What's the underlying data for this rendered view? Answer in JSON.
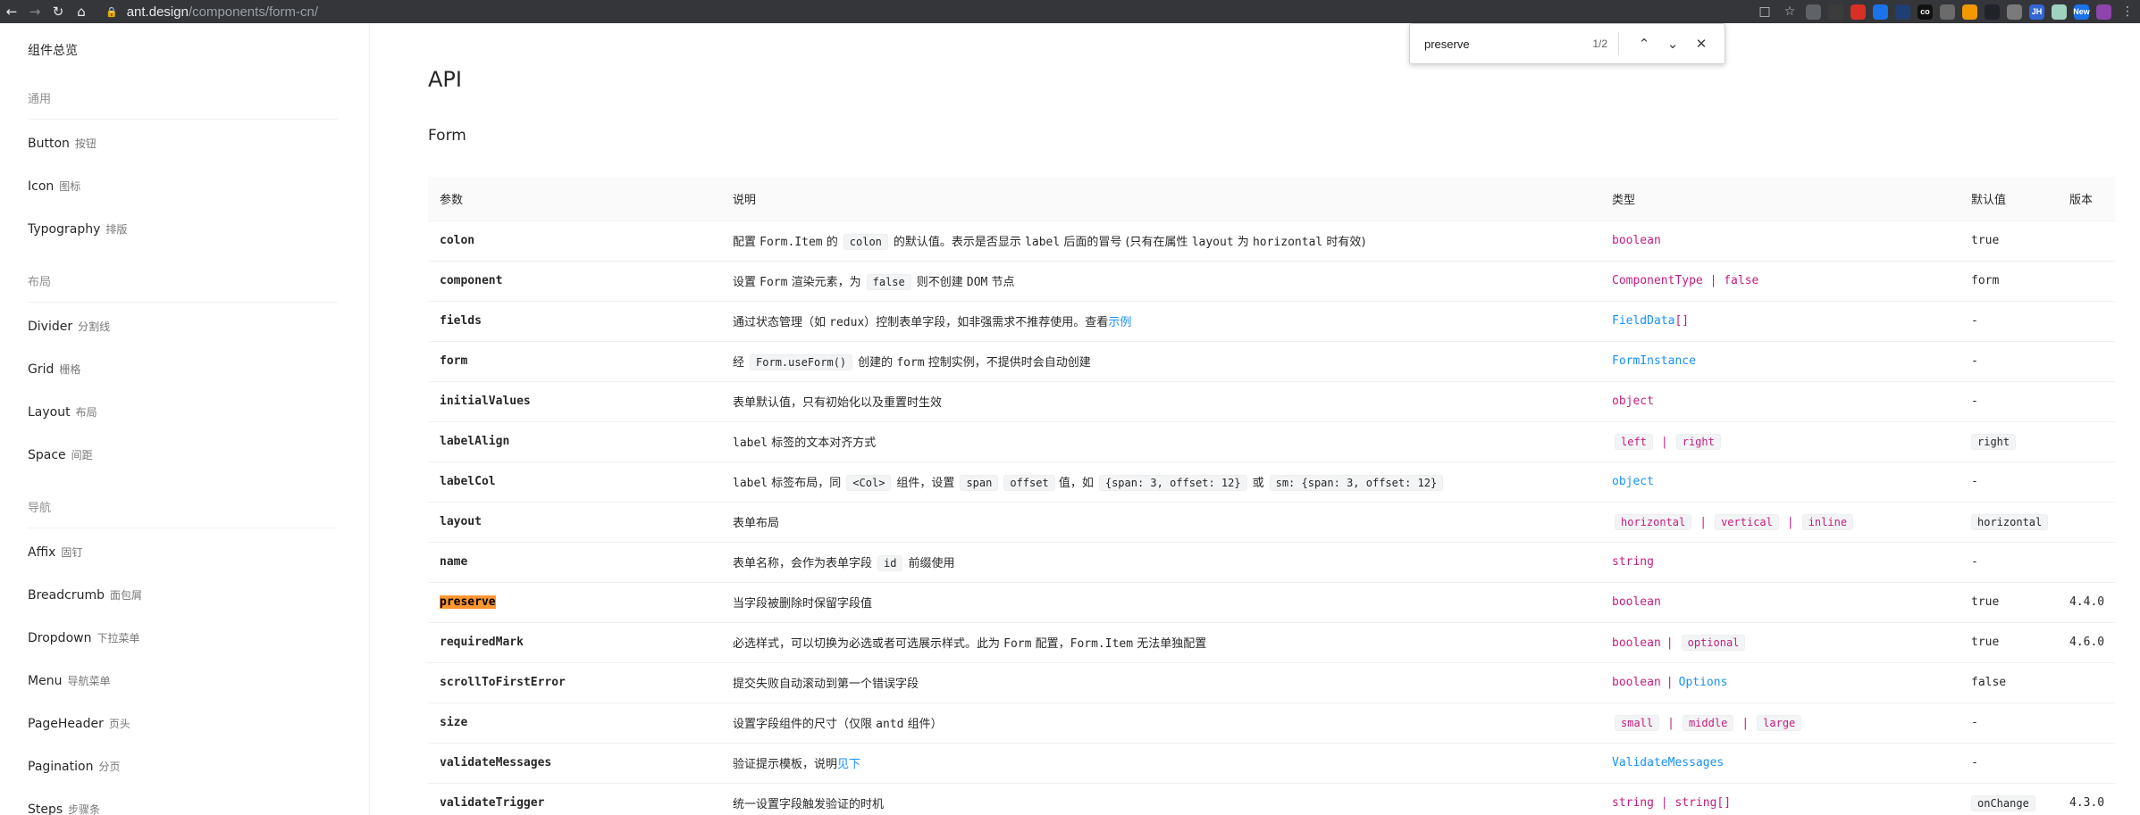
{
  "browser": {
    "url_host": "ant.design",
    "url_path": "/components/form-cn/",
    "find": {
      "query": "preserve",
      "count": "1/2"
    },
    "extensions": [
      {
        "name": "ext-gray",
        "color": "#5f6368",
        "text": ""
      },
      {
        "name": "ext-dark",
        "color": "#3c3c3c",
        "text": ""
      },
      {
        "name": "ext-red",
        "color": "#d93025",
        "text": ""
      },
      {
        "name": "ext-blue",
        "color": "#1a73e8",
        "text": ""
      },
      {
        "name": "ext-navy",
        "color": "#1f3f74",
        "text": ""
      },
      {
        "name": "ext-black",
        "color": "#111111",
        "text": "co"
      },
      {
        "name": "ext-white",
        "color": "#6b6b6b",
        "text": ""
      },
      {
        "name": "ext-chrome",
        "color": "#f29900",
        "text": ""
      },
      {
        "name": "ext-react",
        "color": "#20232a",
        "text": ""
      },
      {
        "name": "ext-circle",
        "color": "#7a7a7a",
        "text": ""
      },
      {
        "name": "ext-jh",
        "color": "#3367d6",
        "text": "JH"
      },
      {
        "name": "ext-green",
        "color": "#9fd3c0",
        "text": ""
      },
      {
        "name": "ext-new",
        "color": "#1a73e8",
        "text": "New"
      },
      {
        "name": "ext-moon",
        "color": "#8e44ad",
        "text": ""
      }
    ]
  },
  "sidebar": {
    "overview": "组件总览",
    "groups": [
      {
        "label": "通用",
        "items": [
          {
            "en": "Button",
            "cn": "按钮"
          },
          {
            "en": "Icon",
            "cn": "图标"
          },
          {
            "en": "Typography",
            "cn": "排版"
          }
        ]
      },
      {
        "label": "布局",
        "items": [
          {
            "en": "Divider",
            "cn": "分割线"
          },
          {
            "en": "Grid",
            "cn": "栅格"
          },
          {
            "en": "Layout",
            "cn": "布局"
          },
          {
            "en": "Space",
            "cn": "间距"
          }
        ]
      },
      {
        "label": "导航",
        "items": [
          {
            "en": "Affix",
            "cn": "固钉"
          },
          {
            "en": "Breadcrumb",
            "cn": "面包屑"
          },
          {
            "en": "Dropdown",
            "cn": "下拉菜单"
          },
          {
            "en": "Menu",
            "cn": "导航菜单"
          },
          {
            "en": "PageHeader",
            "cn": "页头"
          },
          {
            "en": "Pagination",
            "cn": "分页"
          },
          {
            "en": "Steps",
            "cn": "步骤条"
          }
        ]
      }
    ]
  },
  "main": {
    "title": "API",
    "subtitle": "Form",
    "table": {
      "headers": [
        "参数",
        "说明",
        "类型",
        "默认值",
        "版本"
      ],
      "rows": [
        {
          "param": "colon",
          "default": "true",
          "version": ""
        },
        {
          "param": "component",
          "default": "form",
          "version": ""
        },
        {
          "param": "fields",
          "default": "-",
          "version": ""
        },
        {
          "param": "form",
          "default": "-",
          "version": ""
        },
        {
          "param": "initialValues",
          "default": "-",
          "version": ""
        },
        {
          "param": "labelAlign",
          "default": "right",
          "version": ""
        },
        {
          "param": "labelCol",
          "default": "-",
          "version": ""
        },
        {
          "param": "layout",
          "default": "horizontal",
          "version": ""
        },
        {
          "param": "name",
          "default": "-",
          "version": ""
        },
        {
          "param": "preserve",
          "default": "true",
          "version": "4.4.0"
        },
        {
          "param": "requiredMark",
          "default": "true",
          "version": "4.6.0"
        },
        {
          "param": "scrollToFirstError",
          "default": "false",
          "version": ""
        },
        {
          "param": "size",
          "default": "-",
          "version": ""
        },
        {
          "param": "validateMessages",
          "default": "-",
          "version": ""
        },
        {
          "param": "validateTrigger",
          "default": "onChange",
          "version": "4.3.0"
        }
      ],
      "desc": {
        "colon": {
          "a": "配置",
          "b": "Form.Item",
          "c": "的",
          "d": "colon",
          "e": "的默认值。表示是否显示",
          "f": "label",
          "g": "后面的冒号 (只有在属性",
          "h": "layout",
          "i": "为",
          "j": "horizontal",
          "k": "时有效)"
        },
        "component": {
          "a": "设置",
          "b": "Form",
          "c": "渲染元素，为",
          "d": "false",
          "e": "则不创建",
          "f": "DOM",
          "g": "节点"
        },
        "fields": {
          "a": "通过状态管理（如",
          "b": "redux",
          "c": "）控制表单字段，如非强需求不推荐使用。查看",
          "link": "示例"
        },
        "form": {
          "a": "经",
          "b": "Form.useForm()",
          "c": "创建的",
          "d": "form",
          "e": "控制实例，不提供时会自动创建"
        },
        "initialValues": "表单默认值，只有初始化以及重置时生效",
        "labelAlign": {
          "a": "label",
          "b": "标签的文本对齐方式"
        },
        "labelCol": {
          "a": "label",
          "b": "标签布局，同",
          "c": "<Col>",
          "d": "组件，设置",
          "e": "span",
          "f": "offset",
          "g": "值，如",
          "h": "{span: 3, offset: 12}",
          "i": "或",
          "j": "sm: {span: 3, offset: 12}"
        },
        "layout": "表单布局",
        "name": {
          "a": "表单名称，会作为表单字段",
          "b": "id",
          "c": "前缀使用"
        },
        "preserve": "当字段被删除时保留字段值",
        "requiredMark": {
          "a": "必选样式，可以切换为必选或者可选展示样式。此为",
          "b": "Form",
          "c": "配置，",
          "d": "Form.Item",
          "e": "无法单独配置"
        },
        "scrollToFirstError": "提交失败自动滚动到第一个错误字段",
        "size": {
          "a": "设置字段组件的尺寸（仅限",
          "b": "antd",
          "c": "组件）"
        },
        "validateMessages": {
          "a": "验证提示模板，说明",
          "link": "见下"
        },
        "validateTrigger": "统一设置字段触发验证的时机"
      },
      "types": {
        "colon": "boolean",
        "component": "ComponentType | false",
        "fields": {
          "link": "FieldData",
          "suffix": "[]"
        },
        "form": "FormInstance",
        "initialValues": "object",
        "labelAlign": [
          "left",
          "right"
        ],
        "labelCol": "object",
        "layout": [
          "horizontal",
          "vertical",
          "inline"
        ],
        "name": "string",
        "preserve": "boolean",
        "requiredMark": {
          "a": "boolean",
          "pipe": "|",
          "b": "optional"
        },
        "scrollToFirstError": {
          "a": "boolean",
          "pipe": "|",
          "link": "Options"
        },
        "size": [
          "small",
          "middle",
          "large"
        ],
        "validateMessages": "ValidateMessages",
        "validateTrigger": "string | string[]"
      },
      "pipe": "|"
    }
  },
  "colors": {
    "type_pink": "#c41d7f",
    "link_blue": "#1890ff",
    "find_highlight": "#ff9632",
    "chrome_bg": "#35363a"
  }
}
